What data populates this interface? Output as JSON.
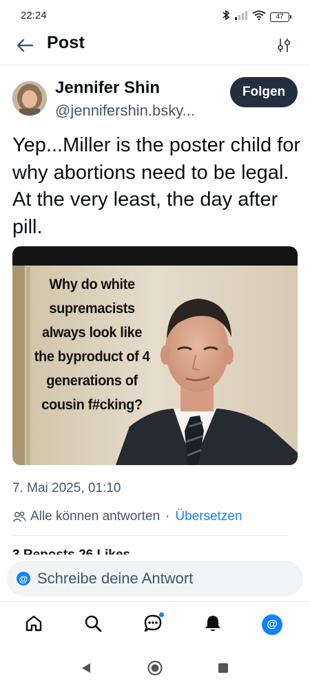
{
  "status_bar": {
    "time": "22:24",
    "battery": "47"
  },
  "header": {
    "title": "Post"
  },
  "post": {
    "author_name": "Jennifer Shin",
    "author_handle": "@jennifershin.bsky...",
    "follow_label": "Folgen",
    "text": "Yep...Miller is the poster child for why abortions need to be legal. At the very least, the day after pill.",
    "image_text": "Why do white supremacists always look like the byproduct of 4 generations of cousin f#cking?",
    "date": "7. Mai 2025, 01:10",
    "reply_permission": "Alle können antworten",
    "separator": "·",
    "translate_label": "Übersetzen",
    "stats_partial": "3 Reposts   26 Likes"
  },
  "composer": {
    "placeholder": "Schreibe deine Antwort",
    "avatar_glyph": "@"
  },
  "tabbar": {
    "items": [
      "home-icon",
      "search-icon",
      "chat-icon",
      "bell-icon",
      "profile-icon"
    ],
    "profile_glyph": "@",
    "accent": "#1083fe"
  },
  "colors": {
    "accent": "#1083fe",
    "follow_bg": "#232e3e",
    "muted": "#42576c"
  }
}
